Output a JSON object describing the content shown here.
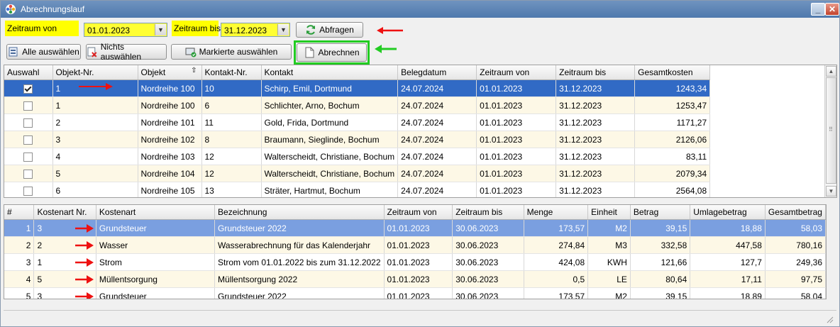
{
  "window": {
    "title": "Abrechnungslauf",
    "min_label": "_",
    "close_label": "✕"
  },
  "filter": {
    "from_label": "Zeitraum von",
    "from_value": "01.01.2023",
    "to_label": "Zeitraum bis",
    "to_value": "31.12.2023",
    "query_button": "Abfragen"
  },
  "toolbar": {
    "select_all": "Alle auswählen",
    "select_none": "Nichts auswählen",
    "select_marked": "Markierte auswählen",
    "settle": "Abrechnen"
  },
  "top_grid": {
    "columns": [
      "Auswahl",
      "Objekt-Nr.",
      "Objekt",
      "Kontakt-Nr.",
      "Kontakt",
      "Belegdatum",
      "Zeitraum von",
      "Zeitraum bis",
      "Gesamtkosten"
    ],
    "rows": [
      {
        "checked": true,
        "objekt_nr": "1",
        "objekt": "Nordreihe 100",
        "kontakt_nr": "10",
        "kontakt": "Schirp, Emil, Dortmund",
        "belegdatum": "24.07.2024",
        "von": "01.01.2023",
        "bis": "31.12.2023",
        "kosten": "1243,34"
      },
      {
        "checked": false,
        "objekt_nr": "1",
        "objekt": "Nordreihe 100",
        "kontakt_nr": "6",
        "kontakt": "Schlichter, Arno, Bochum",
        "belegdatum": "24.07.2024",
        "von": "01.01.2023",
        "bis": "31.12.2023",
        "kosten": "1253,47"
      },
      {
        "checked": false,
        "objekt_nr": "2",
        "objekt": "Nordreihe 101",
        "kontakt_nr": "11",
        "kontakt": "Gold, Frida, Dortmund",
        "belegdatum": "24.07.2024",
        "von": "01.01.2023",
        "bis": "31.12.2023",
        "kosten": "1171,27"
      },
      {
        "checked": false,
        "objekt_nr": "3",
        "objekt": "Nordreihe 102",
        "kontakt_nr": "8",
        "kontakt": "Braumann, Sieglinde, Bochum",
        "belegdatum": "24.07.2024",
        "von": "01.01.2023",
        "bis": "31.12.2023",
        "kosten": "2126,06"
      },
      {
        "checked": false,
        "objekt_nr": "4",
        "objekt": "Nordreihe 103",
        "kontakt_nr": "12",
        "kontakt": "Walterscheidt, Christiane, Bochum",
        "belegdatum": "24.07.2024",
        "von": "01.01.2023",
        "bis": "31.12.2023",
        "kosten": "83,11"
      },
      {
        "checked": false,
        "objekt_nr": "5",
        "objekt": "Nordreihe 104",
        "kontakt_nr": "12",
        "kontakt": "Walterscheidt, Christiane, Bochum",
        "belegdatum": "24.07.2024",
        "von": "01.01.2023",
        "bis": "31.12.2023",
        "kosten": "2079,34"
      },
      {
        "checked": false,
        "objekt_nr": "6",
        "objekt": "Nordreihe 105",
        "kontakt_nr": "13",
        "kontakt": "Sträter, Hartmut, Bochum",
        "belegdatum": "24.07.2024",
        "von": "01.01.2023",
        "bis": "31.12.2023",
        "kosten": "2564,08"
      }
    ]
  },
  "bottom_grid": {
    "columns": [
      "#",
      "Kostenart Nr.",
      "Kostenart",
      "Bezeichnung",
      "Zeitraum von",
      "Zeitraum bis",
      "Menge",
      "Einheit",
      "Betrag",
      "Umlagebetrag",
      "Gesamtbetrag"
    ],
    "rows": [
      {
        "nr": "1",
        "kostenart_nr": "3",
        "kostenart": "Grundsteuer",
        "bezeichnung": "Grundsteuer 2022",
        "von": "01.01.2023",
        "bis": "30.06.2023",
        "menge": "173,57",
        "einheit": "M2",
        "betrag": "39,15",
        "umlage": "18,88",
        "gesamt": "58,03"
      },
      {
        "nr": "2",
        "kostenart_nr": "2",
        "kostenart": "Wasser",
        "bezeichnung": "Wasserabrechnung für das Kalenderjahr",
        "von": "01.01.2023",
        "bis": "30.06.2023",
        "menge": "274,84",
        "einheit": "M3",
        "betrag": "332,58",
        "umlage": "447,58",
        "gesamt": "780,16"
      },
      {
        "nr": "3",
        "kostenart_nr": "1",
        "kostenart": "Strom",
        "bezeichnung": "Strom vom 01.01.2022 bis zum 31.12.2022",
        "von": "01.01.2023",
        "bis": "30.06.2023",
        "menge": "424,08",
        "einheit": "KWH",
        "betrag": "121,66",
        "umlage": "127,7",
        "gesamt": "249,36"
      },
      {
        "nr": "4",
        "kostenart_nr": "5",
        "kostenart": "Müllentsorgung",
        "bezeichnung": "Müllentsorgung 2022",
        "von": "01.01.2023",
        "bis": "30.06.2023",
        "menge": "0,5",
        "einheit": "LE",
        "betrag": "80,64",
        "umlage": "17,11",
        "gesamt": "97,75"
      },
      {
        "nr": "5",
        "kostenart_nr": "3",
        "kostenart": "Grundsteuer",
        "bezeichnung": "Grundsteuer 2022",
        "von": "01.01.2023",
        "bis": "30.06.2023",
        "menge": "173,57",
        "einheit": "M2",
        "betrag": "39,15",
        "umlage": "18,89",
        "gesamt": "58,04"
      }
    ]
  },
  "colors": {
    "highlight_yellow": "#ffff00",
    "selection_blue": "#316ac5",
    "annotation_red": "#ee1111",
    "annotation_green": "#22cc22"
  }
}
